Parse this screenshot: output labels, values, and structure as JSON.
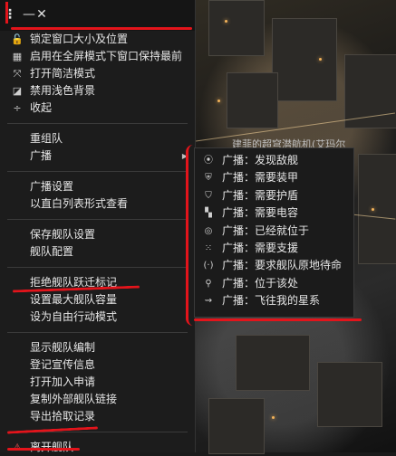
{
  "window": {
    "menu_button_label": "⋮",
    "minimize_label": "—",
    "close_label": "✕"
  },
  "menu": {
    "group1": [
      {
        "icon": "lock-icon",
        "glyph": "🔓",
        "label": "锁定窗口大小及位置"
      },
      {
        "icon": "fullscreen-icon",
        "glyph": "▦",
        "label": "启用在全屏模式下窗口保持最前"
      },
      {
        "icon": "compact-icon",
        "glyph": "⤧",
        "label": "打开简洁模式"
      },
      {
        "icon": "background-icon",
        "glyph": "◪",
        "label": "禁用浅色背景"
      },
      {
        "icon": "collapse-icon",
        "glyph": "÷",
        "label": "收起"
      }
    ],
    "group2": [
      {
        "label": "重组队"
      },
      {
        "label": "广播",
        "has_submenu": true
      }
    ],
    "group3": [
      {
        "label": "广播设置"
      },
      {
        "label": "以直白列表形式查看"
      }
    ],
    "group4": [
      {
        "label": "保存舰队设置"
      },
      {
        "label": "舰队配置"
      }
    ],
    "group5": [
      {
        "label": "拒绝舰队跃迁标记"
      },
      {
        "label": "设置最大舰队容量"
      },
      {
        "label": "设为自由行动模式"
      }
    ],
    "group6": [
      {
        "label": "显示舰队编制"
      },
      {
        "label": "登记宣传信息"
      },
      {
        "label": "打开加入申请"
      },
      {
        "label": "复制外部舰队链接"
      },
      {
        "label": "导出拾取记录"
      }
    ],
    "group7": [
      {
        "icon": "warning-icon",
        "glyph": "⚠",
        "label": "离开舰队"
      }
    ]
  },
  "submenu": {
    "items": [
      {
        "icon": "target-icon",
        "glyph": "⦿",
        "label": "广播：发现敌舰"
      },
      {
        "icon": "armor-icon",
        "glyph": "⛨",
        "label": "广播：需要装甲"
      },
      {
        "icon": "shield-icon",
        "glyph": "⛉",
        "label": "广播：需要护盾"
      },
      {
        "icon": "capacitor-icon",
        "glyph": "▚",
        "label": "广播：需要电容"
      },
      {
        "icon": "in-position-icon",
        "glyph": "◎",
        "label": "广播：已经就位于"
      },
      {
        "icon": "support-icon",
        "glyph": "⁙",
        "label": "广播：需要支援"
      },
      {
        "icon": "hold-position-icon",
        "glyph": "(·)",
        "label": "广播：要求舰队原地待命"
      },
      {
        "icon": "location-icon",
        "glyph": "⚲",
        "label": "广播：位于该处"
      },
      {
        "icon": "warp-icon",
        "glyph": "⇝",
        "label": "广播：飞往我的星系"
      }
    ]
  },
  "scene": {
    "overlay_text": "建菲的超穹潜航机(艾玛尔"
  }
}
